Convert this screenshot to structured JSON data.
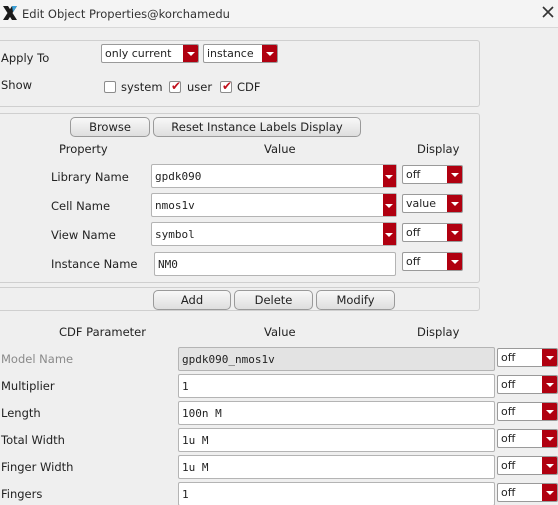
{
  "window": {
    "title": "Edit Object Properties@korchamedu"
  },
  "apply": {
    "label": "Apply To",
    "scope_value": "only current",
    "type_value": "instance"
  },
  "show": {
    "label": "Show",
    "system_label": "system",
    "system_checked": false,
    "user_label": "user",
    "user_checked": true,
    "cdf_label": "CDF",
    "cdf_checked": true
  },
  "buttons": {
    "browse": "Browse",
    "reset": "Reset Instance Labels Display",
    "add": "Add",
    "delete": "Delete",
    "modify": "Modify"
  },
  "prop_headers": {
    "property": "Property",
    "value": "Value",
    "display": "Display"
  },
  "properties": [
    {
      "name": "Library Name",
      "value": "gpdk090",
      "display": "off"
    },
    {
      "name": "Cell Name",
      "value": "nmos1v",
      "display": "value"
    },
    {
      "name": "View Name",
      "value": "symbol",
      "display": "off"
    },
    {
      "name": "Instance Name",
      "value": "NM0",
      "display": "off"
    }
  ],
  "cdf_headers": {
    "parameter": "CDF Parameter",
    "value": "Value",
    "display": "Display"
  },
  "cdf_params": [
    {
      "name": "Model Name",
      "value": "gpdk090_nmos1v",
      "display": "off"
    },
    {
      "name": "Multiplier",
      "value": "1",
      "display": "off"
    },
    {
      "name": "Length",
      "value": "100n M",
      "display": "off"
    },
    {
      "name": "Total Width",
      "value": "1u M",
      "display": "off"
    },
    {
      "name": "Finger Width",
      "value": "1u M",
      "display": "off"
    },
    {
      "name": "Fingers",
      "value": "1",
      "display": "off"
    }
  ]
}
